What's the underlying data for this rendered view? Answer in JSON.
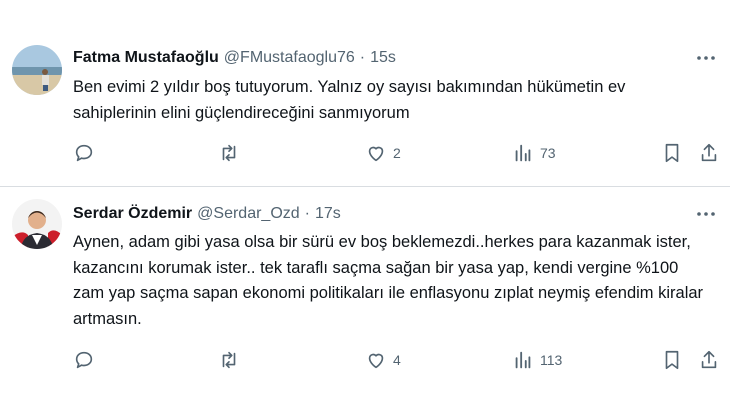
{
  "tweets": [
    {
      "author_name": "Fatma Mustafaoğlu",
      "handle": "@FMustafaoglu76",
      "separator": "·",
      "time": "15s",
      "text": "Ben evimi 2 yıldır boş tutuyorum. Yalnız oy sayısı bakımından hükümetin ev sahiplerinin elini güçlendireceğini sanmıyorum",
      "likes": "2",
      "views": "73"
    },
    {
      "author_name": "Serdar Özdemir",
      "handle": "@Serdar_Ozd",
      "separator": "·",
      "time": "17s",
      "text": "Aynen, adam gibi yasa olsa bir sürü ev boş beklemezdi..herkes para kazanmak ister, kazancını korumak ister.. tek taraflı saçma sağan bir yasa yap, kendi vergine %100 zam yap saçma sapan ekonomi politikaları ile enflasyonu zıplat  neymiş efendim kiralar artmasın.",
      "likes": "4",
      "views": "113"
    }
  ],
  "icons": {
    "reply": "reply-icon",
    "retweet": "retweet-icon",
    "like": "heart-icon",
    "views": "views-icon",
    "bookmark": "bookmark-icon",
    "share": "share-icon",
    "more": "more-icon"
  },
  "colors": {
    "text": "#0f1419",
    "secondary": "#536471",
    "divider": "#d9dde1"
  }
}
